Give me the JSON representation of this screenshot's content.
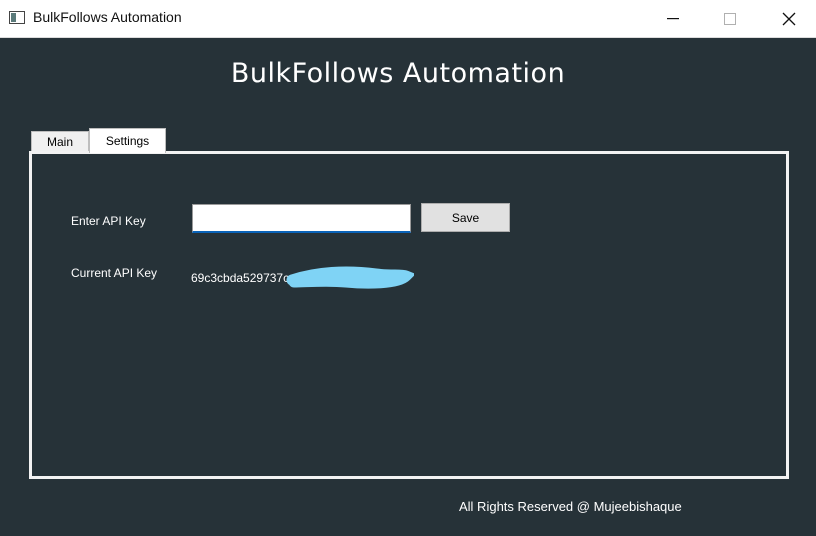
{
  "window": {
    "title": "BulkFollows Automation",
    "icon": "app-window-icon",
    "controls": [
      "minimize-icon",
      "maximize-icon",
      "close-icon"
    ]
  },
  "header": {
    "title": "BulkFollows Automation"
  },
  "tabs": [
    {
      "label": "Main",
      "active": false
    },
    {
      "label": "Settings",
      "active": true
    }
  ],
  "settings": {
    "api_key_label": "Enter API Key",
    "api_key_value": "",
    "save_label": "Save",
    "current_key_label": "Current API Key",
    "current_key_value": "69c3cbda529737c"
  },
  "footer": {
    "text": "All Rights Reserved @ Mujeebishaque"
  },
  "colors": {
    "background": "#263238",
    "panel_border": "#f2f2f2",
    "input_focus": "#0a63b8",
    "redaction": "#7fd3f5"
  }
}
